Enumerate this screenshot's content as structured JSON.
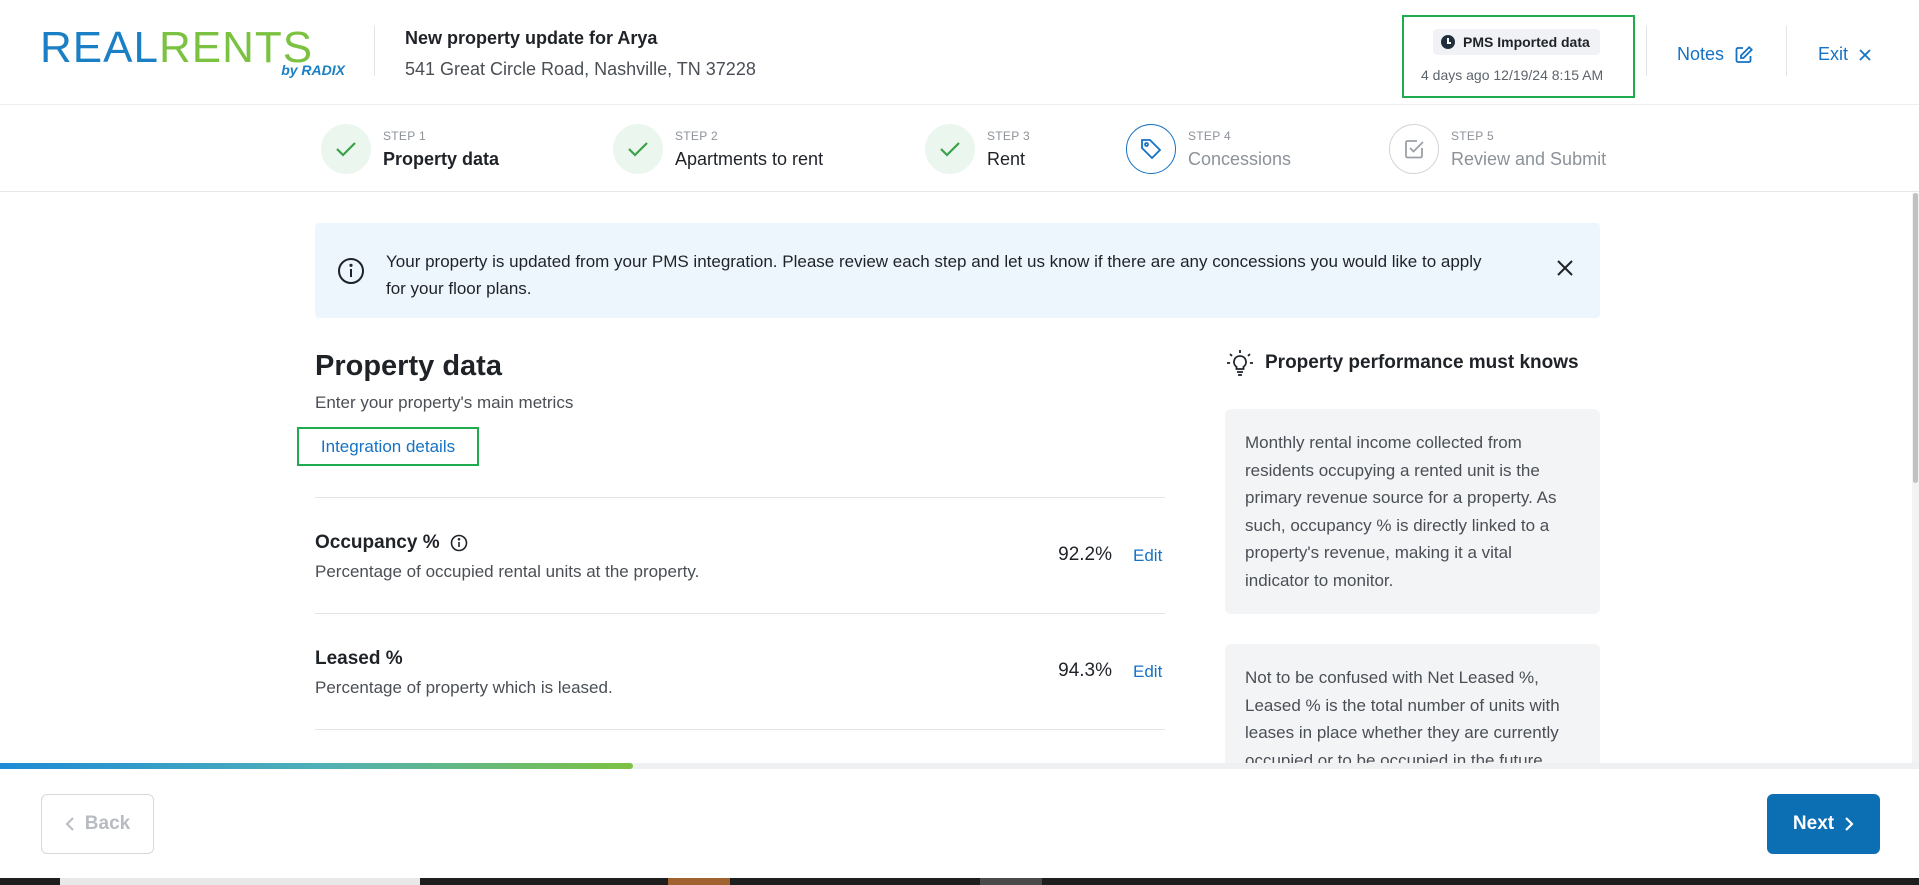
{
  "brand": {
    "real": "REAL",
    "rents": "RENTS",
    "by": "by RADIX"
  },
  "header": {
    "title": "New property update for Arya",
    "address": "541 Great Circle Road, Nashville, TN 37228",
    "pms_label": "PMS Imported data",
    "pms_time": "4 days ago 12/19/24 8:15 AM",
    "notes_label": "Notes",
    "exit_label": "Exit"
  },
  "steps": [
    {
      "num": "STEP 1",
      "name": "Property data",
      "status": "done"
    },
    {
      "num": "STEP 2",
      "name": "Apartments to rent",
      "status": "done"
    },
    {
      "num": "STEP 3",
      "name": "Rent",
      "status": "done"
    },
    {
      "num": "STEP 4",
      "name": "Concessions",
      "status": "current"
    },
    {
      "num": "STEP 5",
      "name": "Review and Submit",
      "status": "todo"
    }
  ],
  "banner": {
    "message": "Your property is updated from your PMS integration. Please review each step and let us know if there are any concessions you would like to apply for your floor plans."
  },
  "section": {
    "title": "Property data",
    "subtitle": "Enter your property's main metrics",
    "integration_label": "Integration details"
  },
  "metrics": [
    {
      "title": "Occupancy %",
      "desc": "Percentage of occupied rental units at the property.",
      "value": "92.2%",
      "edit": "Edit"
    },
    {
      "title": "Leased %",
      "desc": "Percentage of property which is leased.",
      "value": "94.3%",
      "edit": "Edit"
    }
  ],
  "sidebar": {
    "title": "Property performance must knows",
    "cards": [
      "Monthly rental income collected from residents occupying a rented unit is the primary revenue source for a property. As such, occupancy % is directly linked to a property's revenue, making it a vital indicator to monitor.",
      "Not to be confused with Net Leased %, Leased % is the total number of units with leases in place whether they are currently occupied or to be occupied in the future."
    ]
  },
  "progress": {
    "fraction": 0.33
  },
  "footer": {
    "back_label": "Back",
    "next_label": "Next"
  },
  "colors": {
    "brand_blue": "#1a7fc4",
    "brand_green": "#7cc242",
    "link": "#1572c4",
    "primary": "#0c6fb4",
    "highlight": "#1fab4e"
  }
}
